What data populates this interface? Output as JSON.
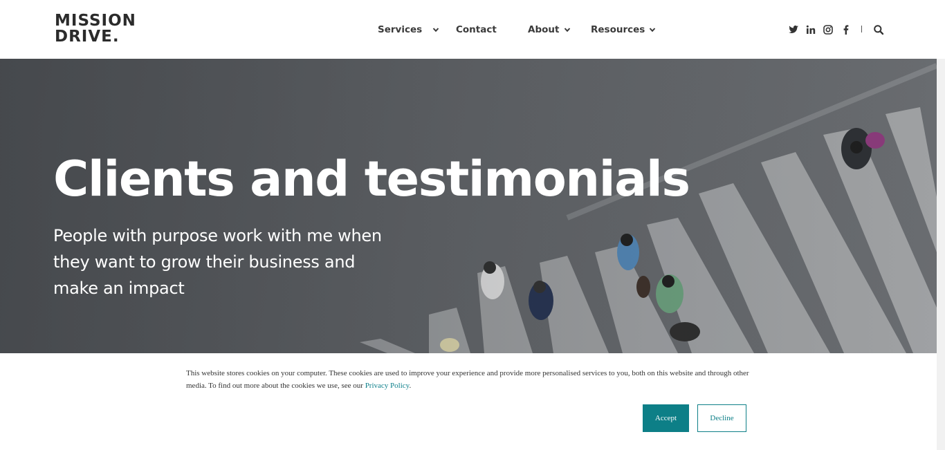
{
  "brand": {
    "logo_line1": "MISSION",
    "logo_line2": "DRIVE."
  },
  "nav": {
    "items": [
      {
        "label": "Services",
        "has_dropdown": true
      },
      {
        "label": "Contact",
        "has_dropdown": false
      },
      {
        "label": "About",
        "has_dropdown": true
      },
      {
        "label": "Resources",
        "has_dropdown": true
      }
    ]
  },
  "social": {
    "icons": [
      "twitter-icon",
      "linkedin-icon",
      "instagram-icon",
      "facebook-icon"
    ],
    "search_icon": "search-icon"
  },
  "hero": {
    "title": "Clients and testimonials",
    "subtitle": "People with purpose work with me when they want to grow their business and make an impact"
  },
  "cookie": {
    "text": "This website stores cookies on your computer. These cookies are used to improve your experience and provide more personalised services to you, both on this website and through other media. To find out more about the cookies we use, see our ",
    "link": "Privacy Policy",
    "text_end": ".",
    "accept": "Accept",
    "decline": "Decline"
  },
  "colors": {
    "accent": "#0d7f87",
    "nav_text": "#3a3a3a",
    "hero_overlay": "#5d6064"
  }
}
